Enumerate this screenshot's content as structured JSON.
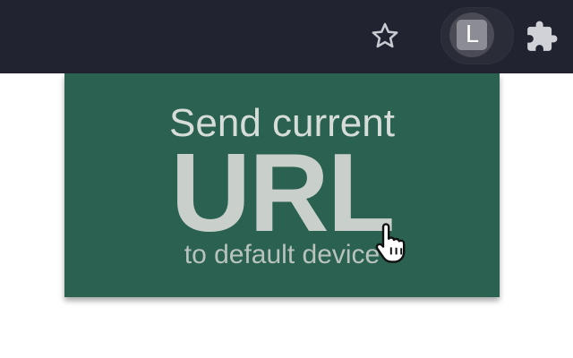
{
  "toolbar": {
    "bookmark_icon": "star-outline-icon",
    "extension_button_letter": "L",
    "extensions_icon": "puzzle-piece-icon"
  },
  "popup": {
    "line1": "Send current",
    "line2": "URL",
    "line3": "to default device",
    "background_color": "#2a6150",
    "text_color": "#c9d0cc"
  },
  "cursor": {
    "icon": "hand-pointer-cursor-icon"
  }
}
